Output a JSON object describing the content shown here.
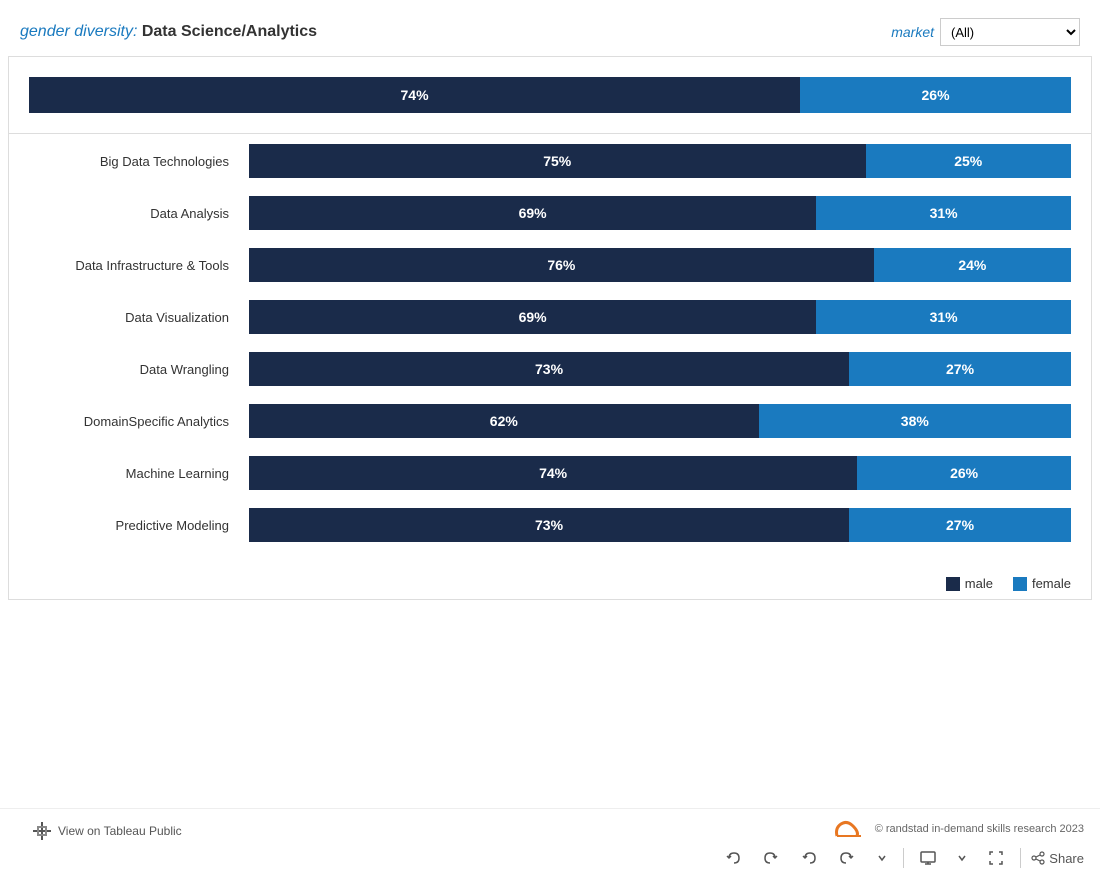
{
  "header": {
    "label": "gender diversity:",
    "title": "Data Science/Analytics",
    "market_label": "market",
    "market_value": "(All)"
  },
  "summary": {
    "male_pct": "74%",
    "female_pct": "26%",
    "male_width": 74,
    "female_width": 26
  },
  "categories": [
    {
      "label": "Big Data Technologies",
      "male_pct": "75%",
      "female_pct": "25%",
      "male_width": 75,
      "female_width": 25
    },
    {
      "label": "Data Analysis",
      "male_pct": "69%",
      "female_pct": "31%",
      "male_width": 69,
      "female_width": 31
    },
    {
      "label": "Data Infrastructure & Tools",
      "male_pct": "76%",
      "female_pct": "24%",
      "male_width": 76,
      "female_width": 24
    },
    {
      "label": "Data Visualization",
      "male_pct": "69%",
      "female_pct": "31%",
      "male_width": 69,
      "female_width": 31
    },
    {
      "label": "Data Wrangling",
      "male_pct": "73%",
      "female_pct": "27%",
      "male_width": 73,
      "female_width": 27
    },
    {
      "label": "DomainSpecific Analytics",
      "male_pct": "62%",
      "female_pct": "38%",
      "male_width": 62,
      "female_width": 38
    },
    {
      "label": "Machine Learning",
      "male_pct": "74%",
      "female_pct": "26%",
      "male_width": 74,
      "female_width": 26
    },
    {
      "label": "Predictive Modeling",
      "male_pct": "73%",
      "female_pct": "27%",
      "male_width": 73,
      "female_width": 27
    }
  ],
  "legend": {
    "male_label": "male",
    "female_label": "female"
  },
  "footer": {
    "copyright": "© randstad in-demand skills research 2023",
    "view_tableau": "View on Tableau Public",
    "share_label": "Share"
  },
  "colors": {
    "male_bar": "#1a2b4a",
    "female_bar": "#2878d0",
    "accent": "#1a7abf"
  }
}
